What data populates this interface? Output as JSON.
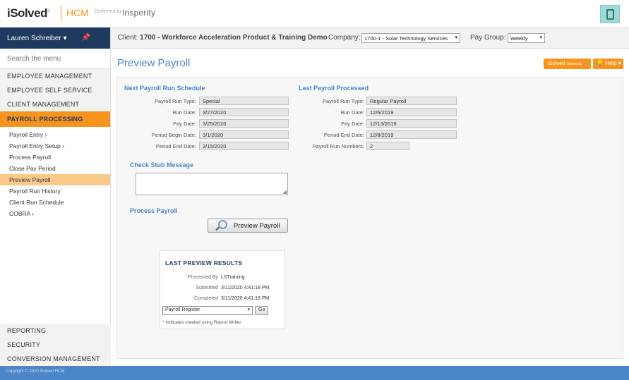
{
  "header": {
    "logo_text": "iSolved",
    "logo_reg": "®",
    "product": "HCM",
    "delivered_by": "Delivered by",
    "partner": "Insperity"
  },
  "user": {
    "name": "Lauren Schreiber",
    "caret": "▾",
    "pin_icon": "pin-icon"
  },
  "search": {
    "placeholder": "Search the menu"
  },
  "menu": {
    "top": [
      "EMPLOYEE MANAGEMENT",
      "EMPLOYEE SELF SERVICE",
      "CLIENT MANAGEMENT"
    ],
    "active": "PAYROLL PROCESSING",
    "sub": [
      "Payroll Entry ›",
      "Payroll Entry Setup ›",
      "Process Payroll",
      "Close Pay Period",
      "Preview Payroll",
      "Payroll Run History",
      "Client Run Schedule",
      "COBRA ›"
    ],
    "active_sub_index": 4,
    "bottom": [
      "REPORTING",
      "SECURITY",
      "CONVERSION MANAGEMENT"
    ]
  },
  "clientbar": {
    "client_label": "Client:",
    "client_value": "1700 - Workforce Acceleration Product & Training Demo",
    "company_label": "Company:",
    "company_value": "1700-1 - Solar Technology Services",
    "paygroup_label": "Pay Group:",
    "paygroup_value": "Weekly"
  },
  "page": {
    "title": "Preview Payroll",
    "univ_button": "iSolved",
    "univ_small": "University",
    "help_button": "💡 Help ▾"
  },
  "next_run": {
    "title": "Next Payroll Run Schedule",
    "fields": [
      {
        "label": "Payroll Run Type:",
        "value": "Special"
      },
      {
        "label": "Run Date:",
        "value": "3/27/2020"
      },
      {
        "label": "Pay Date:",
        "value": "3/25/2020"
      },
      {
        "label": "Period Begin Date:",
        "value": "3/1/2020"
      },
      {
        "label": "Period End Date:",
        "value": "3/15/2020"
      }
    ]
  },
  "last_run": {
    "title": "Last Payroll Processed",
    "fields": [
      {
        "label": "Payroll Run Type:",
        "value": "Regular Payroll"
      },
      {
        "label": "Run Date:",
        "value": "12/6/2019"
      },
      {
        "label": "Pay Date:",
        "value": "12/13/2019"
      },
      {
        "label": "Period End Date:",
        "value": "12/8/2019"
      },
      {
        "label": "Payroll Run Numbers:",
        "value": "2"
      }
    ]
  },
  "check_stub": {
    "title": "Check Stub Message",
    "value": ""
  },
  "process": {
    "title": "Process Payroll",
    "button": "Preview Payroll"
  },
  "results": {
    "title": "LAST PREVIEW RESULTS",
    "processed_by_label": "Processed By",
    "processed_by": "LSTraining",
    "submitted_label": "Submitted",
    "submitted": "3/11/2020 4:41:18 PM",
    "completed_label": "Completed",
    "completed": "3/11/2020 4:41:19 PM",
    "report_select": "Payroll Register",
    "go_button": "Go",
    "note": "* Indicates created using Report Writer"
  },
  "footer": {
    "copyright": "Copyright © 2020 iSolved HCM"
  }
}
